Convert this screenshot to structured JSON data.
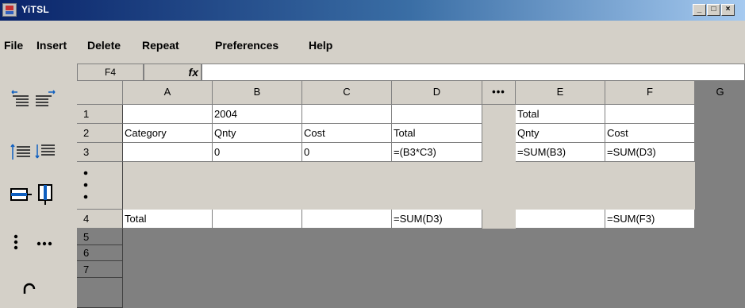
{
  "window": {
    "title": "YiTSL",
    "buttons": {
      "minimize": "_",
      "maximize": "□",
      "close": "×"
    }
  },
  "menu": [
    "File",
    "Insert",
    "Delete",
    "Repeat",
    "Preferences",
    "Help"
  ],
  "toolbar": {
    "icons": [
      "indent-left-icon",
      "indent-right-icon",
      "line-left-icon",
      "line-right-icon",
      "insert-row-icon",
      "insert-column-icon",
      "vertical-ellipsis-icon",
      "horizontal-ellipsis-icon",
      "undo-icon"
    ]
  },
  "formula_bar": {
    "cell_ref": "F4",
    "fx_label": "fx",
    "value": ""
  },
  "grid": {
    "columns": [
      "A",
      "B",
      "C",
      "D",
      "•••",
      "E",
      "F",
      "G"
    ],
    "rows": [
      {
        "header": "1",
        "cells": [
          "",
          "2004",
          "",
          "",
          "Total",
          ""
        ]
      },
      {
        "header": "2",
        "cells": [
          "Category",
          "Qnty",
          "Cost",
          "Total",
          "Qnty",
          "Cost"
        ]
      },
      {
        "header": "3",
        "cells": [
          "",
          "0",
          "0",
          "=(B3*C3)",
          "=SUM(B3)",
          "=SUM(D3)"
        ]
      },
      {
        "header": "4",
        "cells": [
          "Total",
          "",
          "",
          "=SUM(D3)",
          "",
          "=SUM(F3)"
        ]
      }
    ],
    "empty_row_headers": [
      "5",
      "6",
      "7"
    ]
  }
}
